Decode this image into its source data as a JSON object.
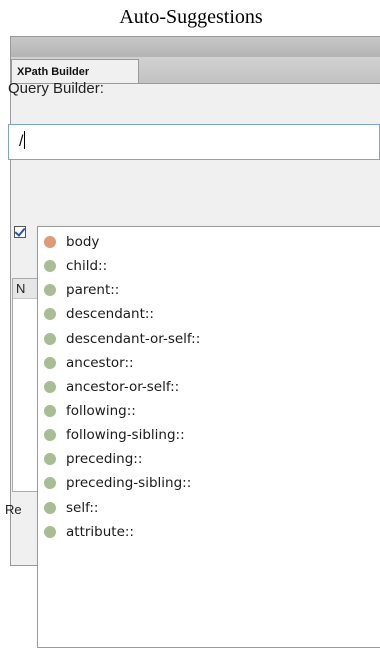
{
  "caption": "Auto-Suggestions",
  "panel": {
    "tab_label": "XPath Builder",
    "query_label": "Query Builder:",
    "query_value": "/",
    "results_header_fragment": "N",
    "results_label_fragment": "Re"
  },
  "suggestions": {
    "items": [
      {
        "label": "body",
        "color": "#e09a78"
      },
      {
        "label": "child::",
        "color": "#a8bd94"
      },
      {
        "label": "parent::",
        "color": "#a8bd94"
      },
      {
        "label": "descendant::",
        "color": "#a8bd94"
      },
      {
        "label": "descendant-or-self::",
        "color": "#a8bd94"
      },
      {
        "label": "ancestor::",
        "color": "#a8bd94"
      },
      {
        "label": "ancestor-or-self::",
        "color": "#a8bd94"
      },
      {
        "label": "following::",
        "color": "#a8bd94"
      },
      {
        "label": "following-sibling::",
        "color": "#a8bd94"
      },
      {
        "label": "preceding::",
        "color": "#a8bd94"
      },
      {
        "label": "preceding-sibling::",
        "color": "#a8bd94"
      },
      {
        "label": "self::",
        "color": "#a8bd94"
      },
      {
        "label": "attribute::",
        "color": "#a8bd94"
      }
    ]
  }
}
